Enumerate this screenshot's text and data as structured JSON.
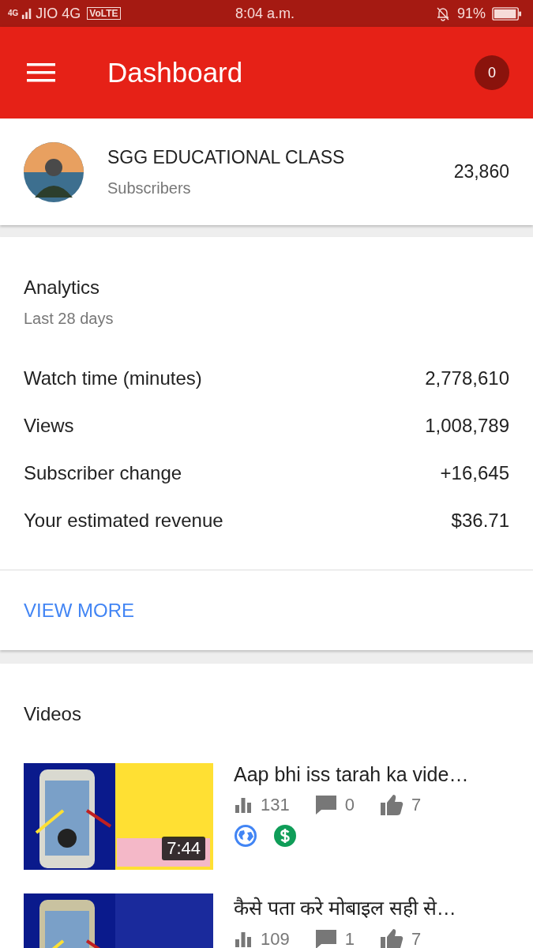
{
  "status_bar": {
    "network_badge": "4G",
    "carrier": "JIO 4G",
    "volte": "VoLTE",
    "time": "8:04 a.m.",
    "battery": "91%"
  },
  "toolbar": {
    "title": "Dashboard",
    "notification_count": "0"
  },
  "channel": {
    "name": "SGG EDUCATIONAL CLASS",
    "label": "Subscribers",
    "subscribers": "23,860"
  },
  "analytics": {
    "title": "Analytics",
    "period": "Last 28 days",
    "metrics": [
      {
        "label": "Watch time (minutes)",
        "value": "2,778,610"
      },
      {
        "label": "Views",
        "value": "1,008,789"
      },
      {
        "label": "Subscriber change",
        "value": "+16,645"
      },
      {
        "label": "Your estimated revenue",
        "value": "$36.71"
      }
    ],
    "link": "VIEW MORE"
  },
  "videos": {
    "title": "Videos",
    "items": [
      {
        "duration": "7:44",
        "title": "Aap bhi iss tarah ka vide…",
        "views": "131",
        "comments": "0",
        "likes": "7",
        "public": true,
        "monetized": true
      },
      {
        "title": "कैसे पता करे मोबाइल सही से…",
        "views": "109",
        "comments": "1",
        "likes": "7"
      }
    ]
  }
}
